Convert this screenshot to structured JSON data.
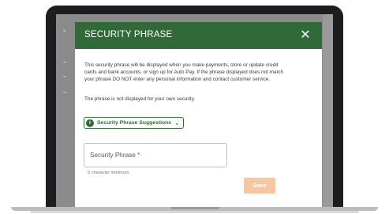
{
  "background": {
    "chevron_rows": [
      "⌄",
      "⌄",
      "⌄",
      "⌄"
    ]
  },
  "modal": {
    "title": "SECURITY PHRASE",
    "close_glyph": "✕",
    "description_lines": [
      "This security phrase will be displayed when you make payments, store or update credit",
      "cards and bank accounts, or sign up for Auto Pay. If the phrase displayed does not match",
      "your phrase DO NOT enter any personal information and contact customer service."
    ],
    "note": "The phrase is not displayed for your own security.",
    "suggestions": {
      "icon_glyph": "i",
      "label": "Security Phrase Suggestions",
      "chevron_glyph": "⌄"
    },
    "phrase_field": {
      "label": "Security Phrase",
      "required_mark": "*",
      "value": ""
    },
    "hint": "5 character minimum.",
    "save_label": "Save"
  },
  "colors": {
    "header_green": "#2f6a38",
    "save_disabled": "#f7c7a0",
    "required_red": "#d32f2f"
  }
}
